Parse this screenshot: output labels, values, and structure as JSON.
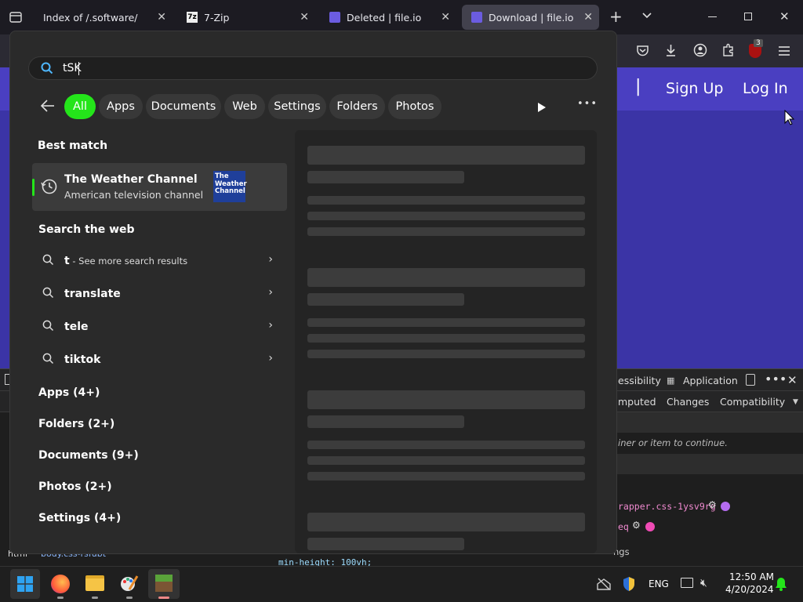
{
  "tabs": [
    {
      "title": "Index of /.software/",
      "active": false
    },
    {
      "title": "7-Zip",
      "active": false
    },
    {
      "title": "Deleted | file.io",
      "active": false
    },
    {
      "title": "Download | file.io",
      "active": true
    }
  ],
  "toolbar": {
    "ublock_badge": "3"
  },
  "page": {
    "signup": "Sign Up",
    "login": "Log In",
    "separator": "|"
  },
  "devtools": {
    "tabs": [
      "essibility",
      "Application"
    ],
    "subtabs": [
      "mputed",
      "Changes",
      "Compatibility"
    ],
    "hint": "iner or item to continue.",
    "code1": "rapper.css-1ysv9rg",
    "code2": "eq",
    "breadcrumb_html": "html",
    "breadcrumb_body": "body.css-rsfubt",
    "css_line": "min-height: 100vh;",
    "right_text": "ngs"
  },
  "search": {
    "query": "tSK",
    "filters": [
      "All",
      "Apps",
      "Documents",
      "Web",
      "Settings",
      "Folders",
      "Photos"
    ],
    "best_match_title": "Best match",
    "best_match": {
      "name": "The Weather Channel",
      "desc": "American television channel",
      "logo": "The Weather Channel"
    },
    "web_title": "Search the web",
    "web_items": [
      {
        "term": "t",
        "suffix": " - See more search results"
      },
      {
        "term": "translate",
        "suffix": ""
      },
      {
        "term": "tele",
        "suffix": ""
      },
      {
        "term": "tiktok",
        "suffix": ""
      }
    ],
    "categories": [
      "Apps (4+)",
      "Folders (2+)",
      "Documents (9+)",
      "Photos (2+)",
      "Settings (4+)"
    ]
  },
  "taskbar": {
    "lang": "ENG",
    "time": "12:50 AM",
    "date": "4/20/2024"
  },
  "colors": {
    "accent_green": "#24e51a",
    "page_purple": "#3b34a6"
  }
}
